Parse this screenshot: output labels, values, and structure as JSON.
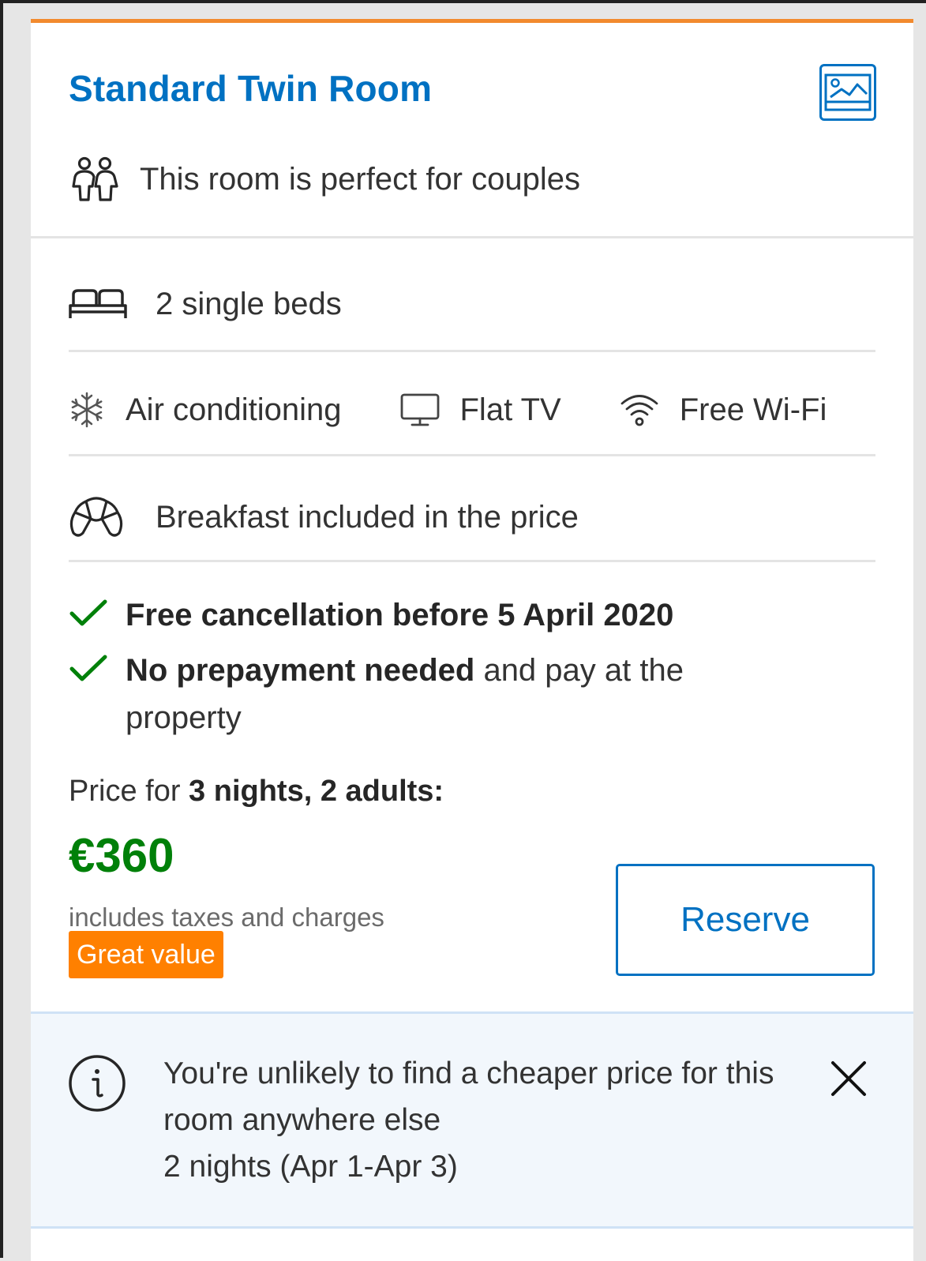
{
  "room": {
    "title": "Standard Twin Room",
    "photo_icon": "image-icon",
    "suitability": "This room is perfect for couples",
    "suitability_icon": "couple-icon"
  },
  "beds": {
    "label": "2 single beds",
    "icon": "bed-icon"
  },
  "facilities": [
    {
      "label": "Air conditioning",
      "icon": "snowflake-icon"
    },
    {
      "label": "Flat TV",
      "icon": "tv-icon"
    },
    {
      "label": "Free Wi-Fi",
      "icon": "wifi-icon"
    }
  ],
  "breakfast": {
    "label": "Breakfast included in the price",
    "icon": "croissant-icon"
  },
  "conditions": {
    "cancellation": "Free cancellation before 5 April 2020",
    "prepayment_bold": "No prepayment needed",
    "prepayment_rest": " and pay at the property",
    "check_icon": "checkmark-icon"
  },
  "pricing": {
    "label_prefix": "Price for ",
    "label_bold": "3 nights, 2 adults:",
    "amount": "€360",
    "taxes_note": "includes taxes and charges",
    "badge": "Great value",
    "reserve_label": "Reserve"
  },
  "notice": {
    "line1": "You're unlikely to find a cheaper price for this room anywhere else",
    "line2": "2 nights (Apr 1-Apr 3)",
    "info_icon": "info-icon",
    "close_icon": "close-icon"
  },
  "colors": {
    "brand_blue": "#0071c2",
    "price_green": "#008009",
    "accent_orange": "#f28a2e",
    "badge_orange": "#ff8000"
  }
}
